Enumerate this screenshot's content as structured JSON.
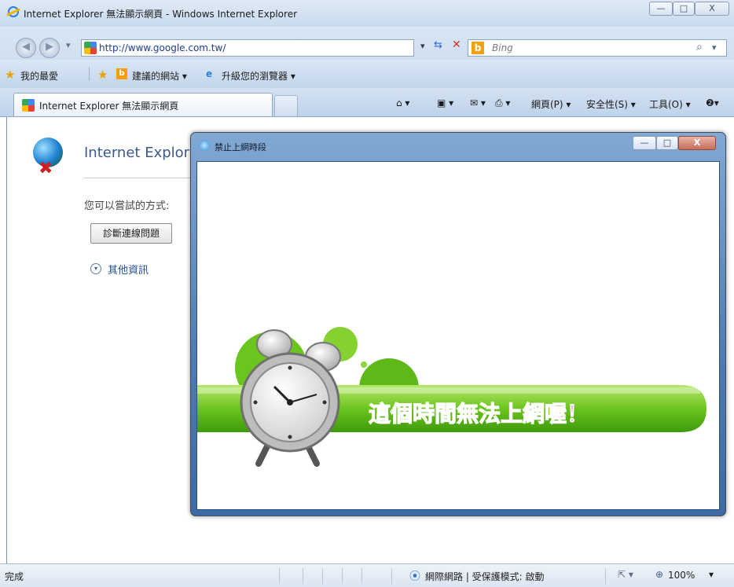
{
  "window": {
    "title": "Internet Explorer 無法顯示網頁 - Windows Internet Explorer",
    "minimize_glyph": "—",
    "maximize_glyph": "□",
    "close_glyph": "X"
  },
  "address": {
    "url": "http://www.google.com.tw/",
    "search_placeholder": "Bing",
    "back_glyph": "◀",
    "forward_glyph": "▶",
    "dropdown_glyph": "▾",
    "refresh_glyph": "⇆",
    "stop_glyph": "✕",
    "search_glyph": "⌕"
  },
  "favorites": {
    "favorites_label": "我的最愛",
    "suggested_sites_label": "建議的網站 ▾",
    "upgrade_label": "升級您的瀏覽器 ▾"
  },
  "tabs": {
    "active_tab_label": "Internet Explorer 無法顯示網頁"
  },
  "command_bar": {
    "home_glyph": "⌂ ▾",
    "feeds_glyph": "▣ ▾",
    "mail_glyph": "✉ ▾",
    "print_glyph": "⎙ ▾",
    "page_label": "網頁(P) ▾",
    "safety_label": "安全性(S) ▾",
    "tools_label": "工具(O) ▾",
    "help_glyph": "❷▾"
  },
  "error_page": {
    "title": "Internet Explor",
    "try_label": "您可以嘗試的方式:",
    "diagnose_button": "診斷連線問題",
    "more_info_label": "其他資訊",
    "more_info_glyph": "▾"
  },
  "popup": {
    "title": "禁止上網時段",
    "banner_text": "這個時間無法上網喔！",
    "minimize_glyph": "—",
    "maximize_glyph": "□",
    "close_glyph": "X"
  },
  "status": {
    "text": "完成",
    "zone": "網際網路 | 受保護模式: 啟動",
    "zoom": "100%",
    "zoom_glyph": "⊕",
    "zone_icon_glyph": "⦿",
    "protected_glyph": "⇱ ▾",
    "zoom_dropdown": "▾"
  },
  "colors": {
    "banner_green": "#5fb81a",
    "banner_text": "#e0318a"
  }
}
